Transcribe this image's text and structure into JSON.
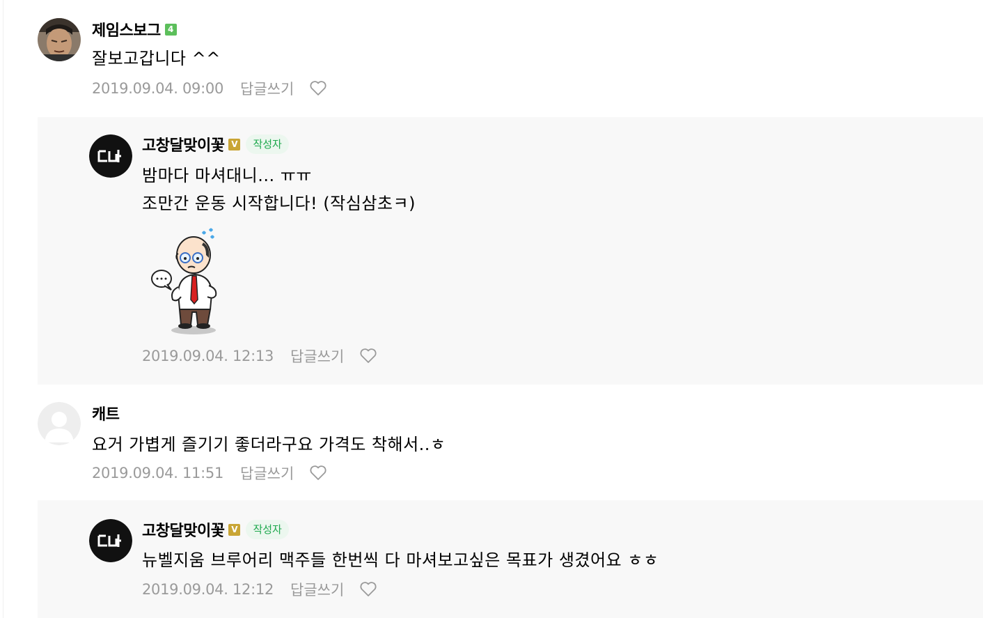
{
  "comments": [
    {
      "nickname": "제임스보그",
      "level": "4",
      "text": "잘보고갑니다 ^^",
      "date": "2019.09.04. 09:00",
      "reply_label": "답글쓰기",
      "avatar": "photo-avatar"
    },
    {
      "nickname": "고창달맞이꽃",
      "verified": "V",
      "author_badge": "작성자",
      "text_lines": [
        "밤마다 마셔대니... ㅠㅠ",
        "조만간 운동 시작합니다! (작심삼초ㅋ)"
      ],
      "sticker": "sweating-old-man-sticker",
      "date": "2019.09.04. 12:13",
      "reply_label": "답글쓰기",
      "avatar": "logo-avatar"
    },
    {
      "nickname": "캐트",
      "text": "요거 가볍게 즐기기 좋더라구요 가격도 착해서..ㅎ",
      "date": "2019.09.04. 11:51",
      "reply_label": "답글쓰기",
      "avatar": "default-avatar"
    },
    {
      "nickname": "고창달맞이꽃",
      "verified": "V",
      "author_badge": "작성자",
      "text": "뉴벨지움 브루어리 맥주들 한번씩 다 마셔보고싶은 목표가 생겼어요 ㅎㅎ",
      "date": "2019.09.04. 12:12",
      "reply_label": "답글쓰기",
      "avatar": "logo-avatar"
    }
  ],
  "colors": {
    "reply_bg": "#f8f8f8",
    "meta_text": "#9a9a9a",
    "level_badge": "#5cbf5b",
    "verified_badge": "#c9a535",
    "author_badge_bg": "#ecf7ef",
    "author_badge_text": "#1ca84c"
  }
}
